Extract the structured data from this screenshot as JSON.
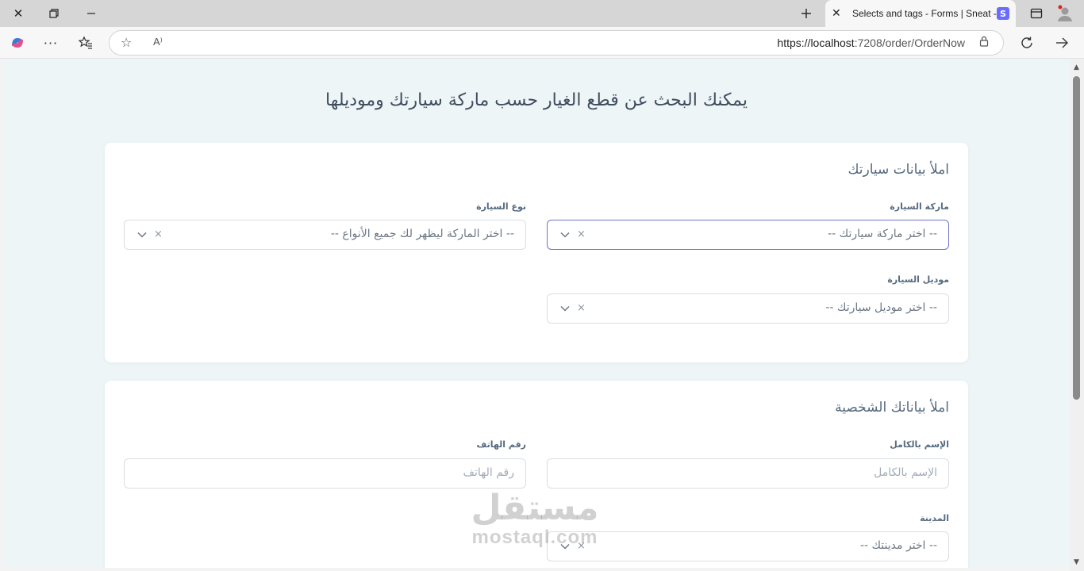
{
  "browser": {
    "tab_title": "Selects and tags - Forms | Sneat -",
    "tab_favicon": "S",
    "url_host": "https://localhost",
    "url_rest": ":7208/order/OrderNow",
    "reader_icon_text": "A⁾"
  },
  "page": {
    "heading": "يمكنك البحث عن قطع الغيار حسب ماركة سيارتك وموديلها"
  },
  "car_card": {
    "title": "املأ بيانات سيارتك",
    "brand_label": "ماركة السيارة",
    "brand_placeholder": "-- اختر ماركة سيارتك --",
    "type_label": "نوع السيارة",
    "type_placeholder": "-- اختر الماركة ليظهر لك جميع الأنواع --",
    "model_label": "موديل السيارة",
    "model_placeholder": "-- اختر موديل سيارتك --"
  },
  "personal_card": {
    "title": "املأ بياناتك الشخصية",
    "name_label": "الإسم بالكامل",
    "name_placeholder": "الإسم بالكامل",
    "phone_label": "رقم الهاتف",
    "phone_placeholder": "رقم الهاتف",
    "city_label": "المدينة",
    "city_placeholder": "-- اختر مدينتك --"
  },
  "select_clear_glyph": "×",
  "watermark": {
    "arabic": "مستقل",
    "latin": "mostaql.com"
  },
  "colors": {
    "accent": "#696cff",
    "page_bg": "#eef5f7",
    "focus_border": "#6f73c9"
  }
}
